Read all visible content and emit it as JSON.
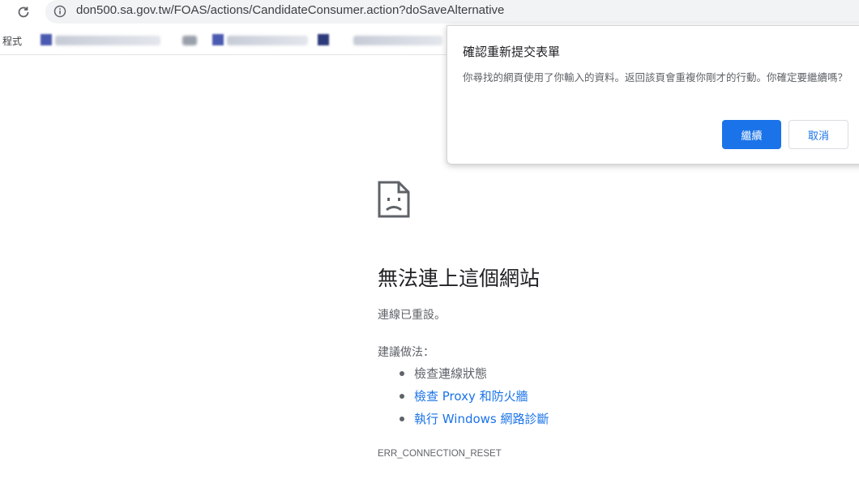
{
  "browser": {
    "url": "don500.sa.gov.tw/FOAS/actions/CandidateConsumer.action?doSaveAlternative",
    "bookmarks_bar_label": "程式"
  },
  "dialog": {
    "title": "確認重新提交表單",
    "message": "你尋找的網頁使用了你輸入的資料。返回該頁會重複你剛才的行動。你確定要繼續嗎？",
    "continue_label": "繼續",
    "cancel_label": "取消",
    "accent_color": "#1a73e8"
  },
  "error_page": {
    "icon": "sad-document-icon",
    "heading": "無法連上這個網站",
    "reason": "連線已重設。",
    "suggestions_title": "建議做法：",
    "suggestions": [
      {
        "text": "檢查連線狀態",
        "link": false
      },
      {
        "text": "檢查 Proxy 和防火牆",
        "link": true
      },
      {
        "text": "執行 Windows 網路診斷",
        "link": true
      }
    ],
    "error_code": "ERR_CONNECTION_RESET"
  }
}
